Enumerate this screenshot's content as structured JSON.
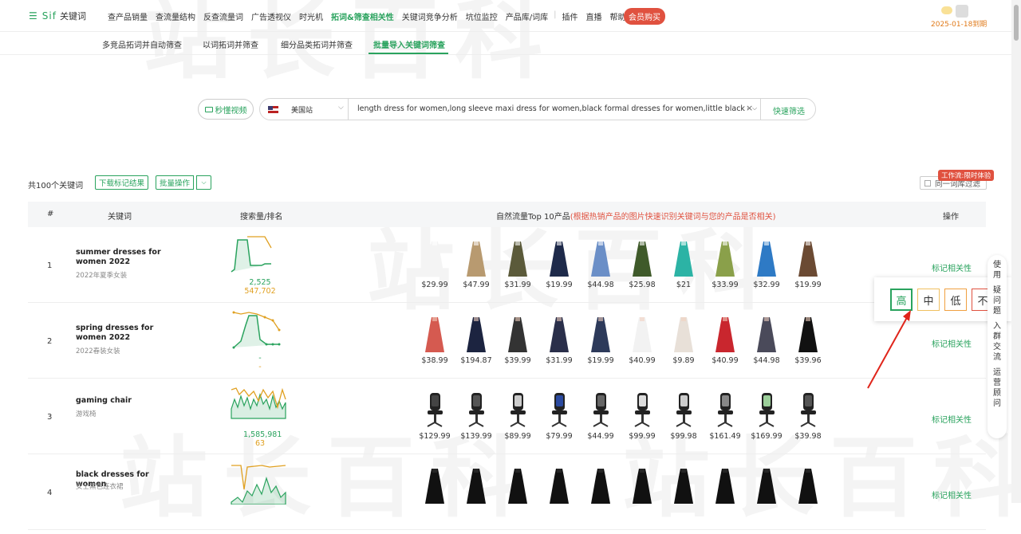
{
  "header": {
    "logo_text": "Sif",
    "logo_cn": "关键词",
    "nav": [
      "查产品销量",
      "查流量结构",
      "反查流量词",
      "广告透视仪",
      "时光机",
      "拓词&筛查相关性",
      "关键词竞争分析",
      "坑位监控",
      "产品库/词库",
      "插件",
      "直播",
      "帮助"
    ],
    "nav_active_index": 5,
    "vip_label": "会员购买",
    "expire_text": "2025-01-18到期"
  },
  "subnav": [
    "多竞品拓词并自动筛查",
    "以词拓词并筛查",
    "细分品类拓词并筛查",
    "批量导入关键词筛查"
  ],
  "subnav_active_index": 3,
  "search": {
    "video_label": "秒懂视频",
    "station": "美国站",
    "query": "length dress for women,long sleeve maxi dress for women,black formal dresses for women,little black dress for w",
    "quick_label": "快速筛选"
  },
  "toolbar": {
    "total": "共100个关键词",
    "download_label": "下载标记结果",
    "batch_label": "批量操作",
    "workflow_badge": "工作流:限时体验",
    "same_filter_label": "同一词库过滤"
  },
  "table": {
    "headers": {
      "idx": "#",
      "keyword": "关键词",
      "volume": "搜索量/排名",
      "products": "自然流量Top 10产品",
      "products_note": "(根据热销产品的图片快速识别关键词与您的产品是否相关)",
      "action": "操作"
    },
    "mark_label": "标记相关性",
    "rows": [
      {
        "idx": "1",
        "keyword": "summer dresses for women 2022",
        "keyword_cn": "2022年夏季女装",
        "volume": "2,525",
        "rank": "547,702",
        "prices": [
          "$29.99",
          "$47.99",
          "$31.99",
          "$19.99",
          "$44.98",
          "$25.98",
          "$21",
          "$33.99",
          "$32.99",
          "$19.99"
        ]
      },
      {
        "idx": "2",
        "keyword": "spring dresses for women 2022",
        "keyword_cn": "2022春装女装",
        "volume": "-",
        "rank": "-",
        "prices": [
          "$38.99",
          "$194.87",
          "$39.99",
          "$31.99",
          "$19.99",
          "$40.99",
          "$9.89",
          "$40.99",
          "$44.98",
          "$39.96"
        ]
      },
      {
        "idx": "3",
        "keyword": "gaming chair",
        "keyword_cn": "游戏椅",
        "volume": "1,585,981",
        "rank": "63",
        "prices": [
          "$129.99",
          "$139.99",
          "$89.99",
          "$79.99",
          "$44.99",
          "$99.99",
          "$99.98",
          "$161.49",
          "$169.99",
          "$39.98"
        ]
      },
      {
        "idx": "4",
        "keyword": "black dresses for women",
        "keyword_cn": "女士黑色连衣裙",
        "volume": "",
        "rank": "",
        "prices": [
          "",
          "",
          "",
          "",
          "",
          "",
          "",
          "",
          "",
          ""
        ]
      }
    ]
  },
  "relevance_popup": [
    "高",
    "中",
    "低",
    "不"
  ],
  "side_tab": [
    "使",
    "用",
    "疑",
    "问",
    "题",
    "入",
    "群",
    "交",
    "流",
    "运",
    "营",
    "顾",
    "问"
  ],
  "watermark": "站长百科",
  "colors": {
    "accent": "#2aa35e",
    "danger": "#e0513f",
    "rank": "#e0a020"
  }
}
